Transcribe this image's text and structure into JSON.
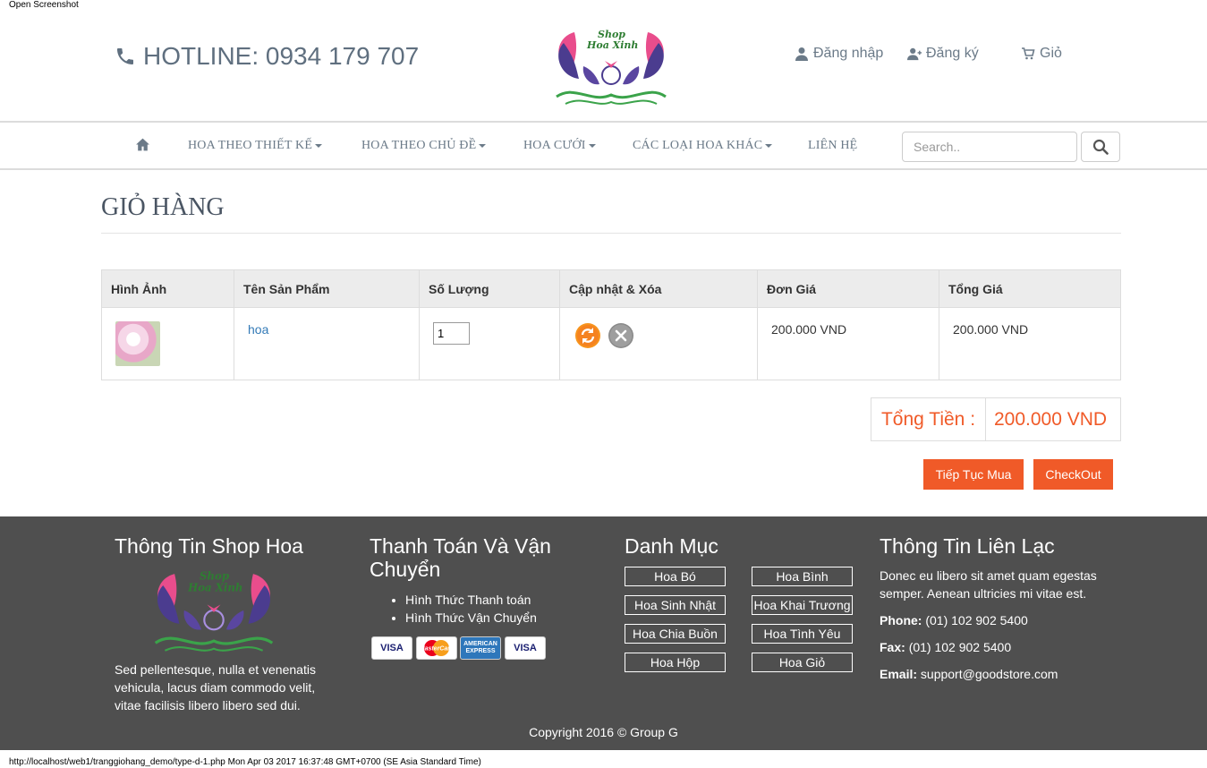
{
  "screenshot_note": "Open Screenshot",
  "header": {
    "hotline": "HOTLINE: 0934 179 707",
    "logo_text_line1": "Shop",
    "logo_text_line2": "Hoa Xinh",
    "login": "Đăng nhập",
    "register": "Đăng ký",
    "cart": "Giỏ"
  },
  "nav": {
    "items": [
      {
        "label": "HOA THEO THIẾT KẾ",
        "dropdown": true
      },
      {
        "label": "HOA THEO CHỦ ĐỀ",
        "dropdown": true
      },
      {
        "label": "HOA CƯỚI",
        "dropdown": true
      },
      {
        "label": "CÁC LOẠI HOA KHÁC",
        "dropdown": true
      },
      {
        "label": "LIÊN HỆ",
        "dropdown": false
      }
    ],
    "search_placeholder": "Search.."
  },
  "page": {
    "title": "GIỎ HÀNG"
  },
  "cart": {
    "headers": [
      "Hình Ảnh",
      "Tên Sản Phẩm",
      "Số Lượng",
      "Cập nhật & Xóa",
      "Đơn Giá",
      "Tổng Giá"
    ],
    "rows": [
      {
        "name": "hoa",
        "quantity": "1",
        "unit_price": "200.000 VND",
        "total_price": "200.000 VND"
      }
    ],
    "total_label": "Tổng Tiền :",
    "total_value": "200.000 VND",
    "continue_label": "Tiếp Tục Mua",
    "checkout_label": "CheckOut"
  },
  "footer": {
    "col1_title": "Thông Tin Shop Hoa",
    "col1_text": "Sed pellentesque, nulla et venenatis vehicula, lacus diam commodo velit, vitae facilisis libero libero sed dui.",
    "col2_title": "Thanh Toán Và Vận Chuyển",
    "col2_items": [
      "Hình Thức Thanh toán",
      "Hình Thức Vận Chuyển"
    ],
    "cards": [
      "VISA",
      "MasterCard",
      "AMERICAN EXPRESS",
      "VISA"
    ],
    "col3_title": "Danh Mục",
    "categories": [
      "Hoa Bó",
      "Hoa Bình",
      "Hoa Sinh Nhật",
      "Hoa Khai Trương",
      "Hoa Chia Buồn",
      "Hoa Tình Yêu",
      "Hoa Hộp",
      "Hoa Giỏ"
    ],
    "col4_title": "Thông Tin Liên Lạc",
    "col4_text": "Donec eu libero sit amet quam egestas semper. Aenean ultricies mi vitae est.",
    "phone_label": "Phone:",
    "phone": "(01) 102 902 5400",
    "fax_label": "Fax:",
    "fax": "(01) 102 902 5400",
    "email_label": "Email:",
    "email": "support@goodstore.com",
    "copyright": "Copyright 2016 © Group G"
  },
  "status_bar": "http://localhost/web1/tranggiohang_demo/type-d-1.php Mon Apr 03 2017 16:37:48 GMT+0700 (SE Asia Standard Time)",
  "colors": {
    "accent": "#f05a28",
    "footer_bg": "#4f4f4f",
    "nav_text": "#6b7a88",
    "link": "#337ab7"
  }
}
